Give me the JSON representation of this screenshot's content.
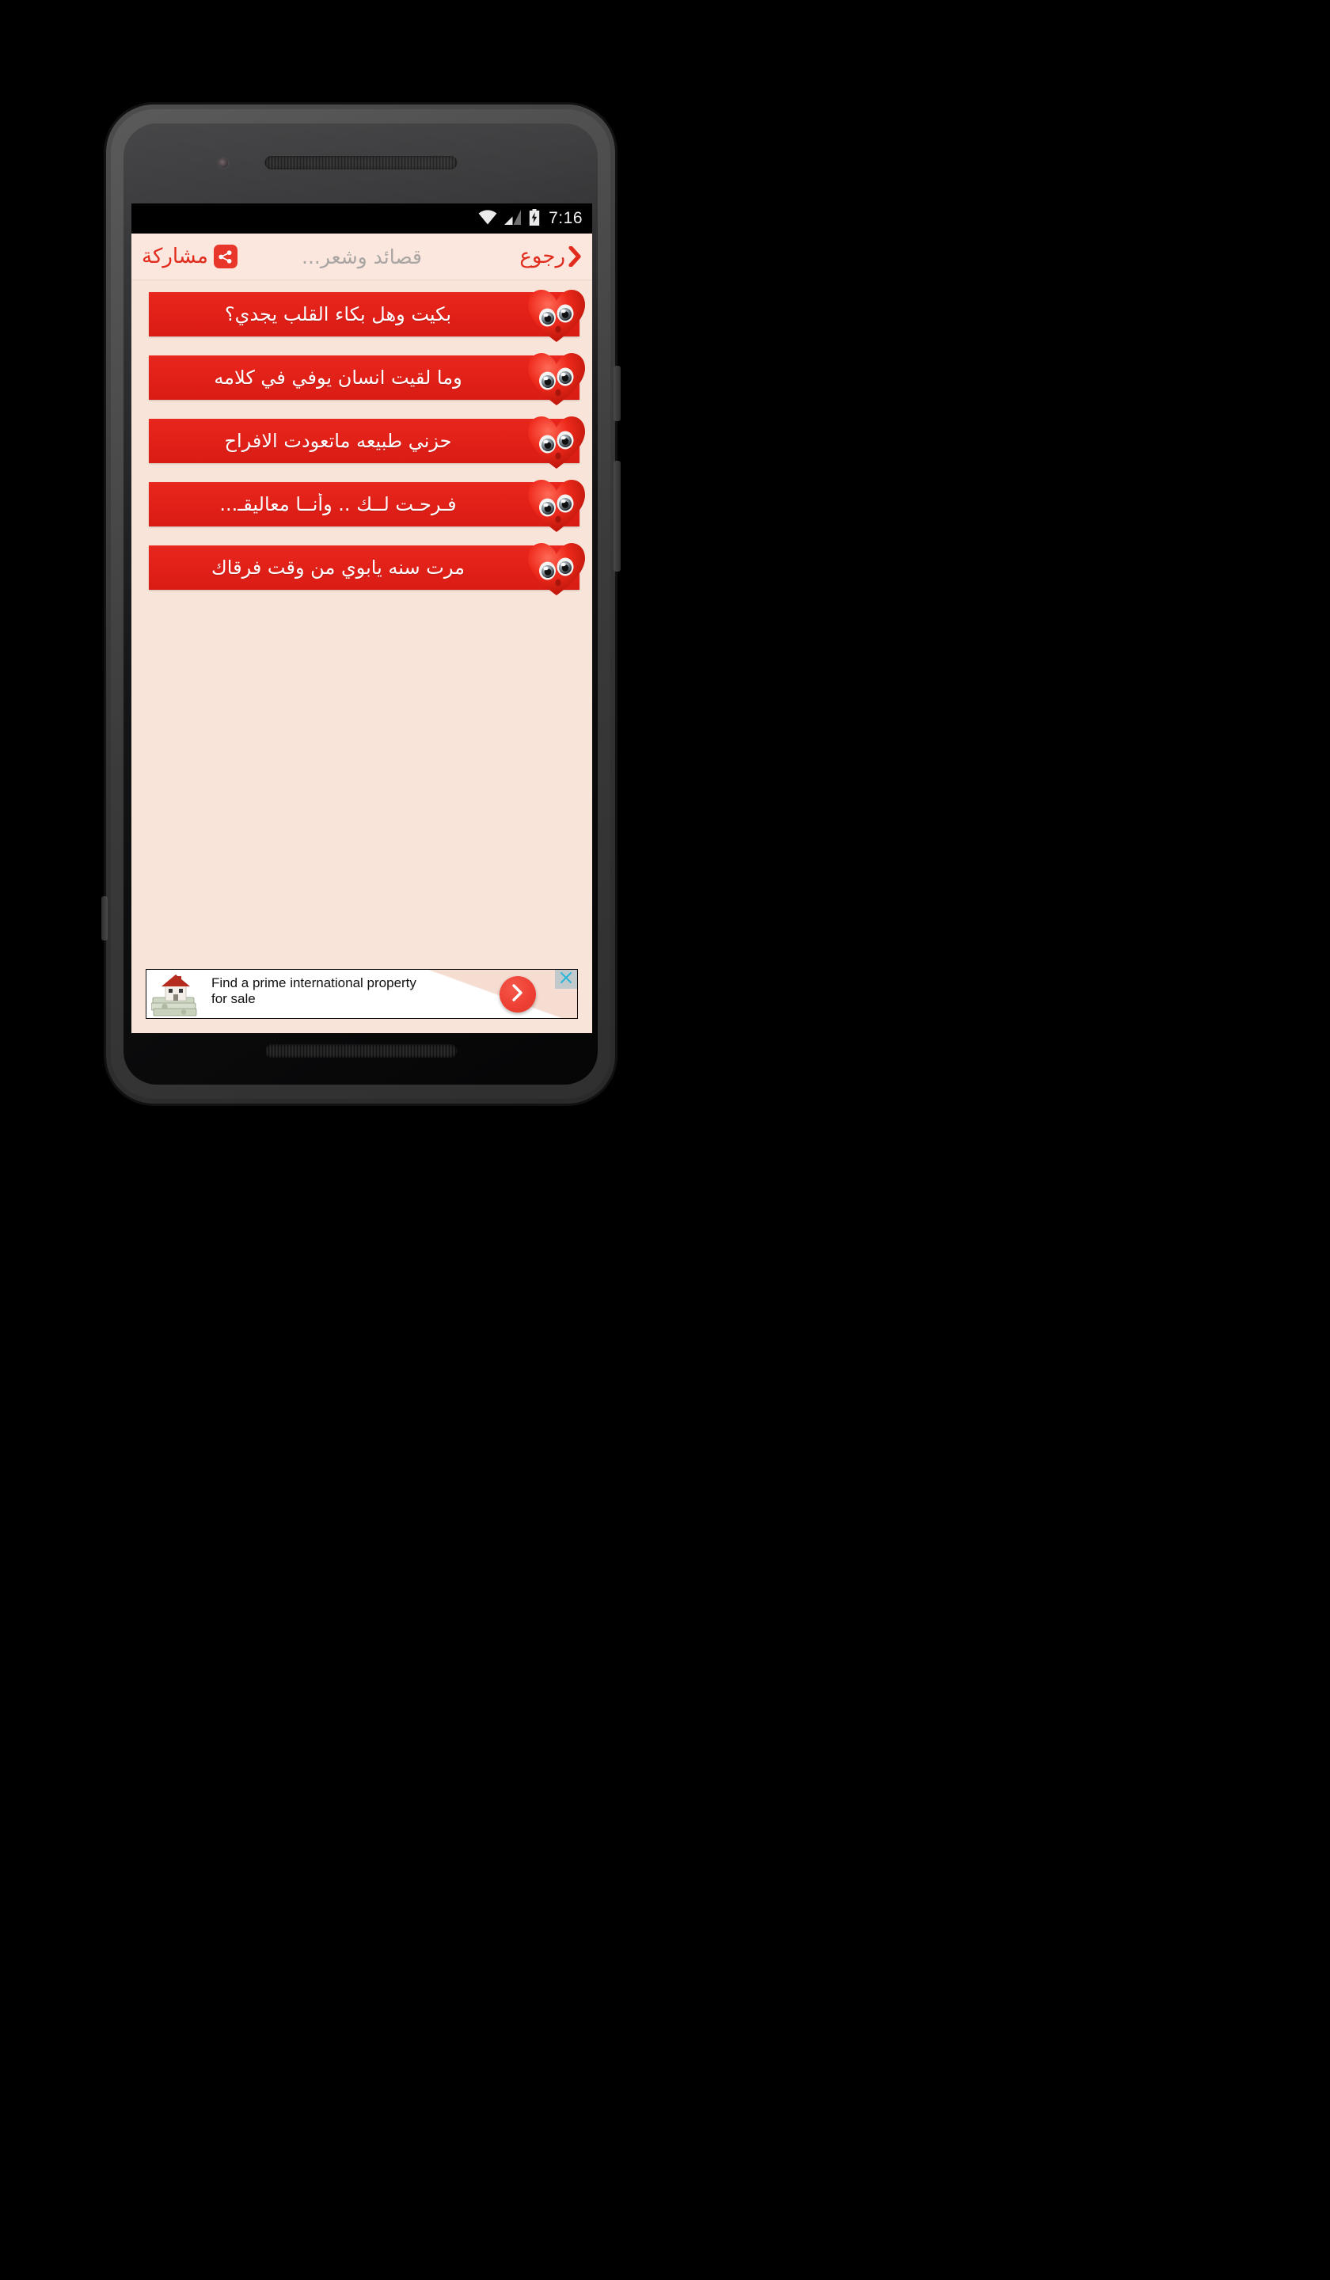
{
  "status_bar": {
    "time": "7:16",
    "icons": [
      "wifi-icon",
      "cellular-signal-icon",
      "battery-charging-icon"
    ]
  },
  "app_bar": {
    "back_label": "رجوع",
    "back_icon": "chevron-right-icon",
    "title": "قصائد وشعر...",
    "share_label": "مشاركة",
    "share_icon": "share-icon",
    "background_color": "#fbe7de",
    "accent_color": "#e02b1d",
    "title_color": "#a9a5a3"
  },
  "screen": {
    "background_color": "#f9e4da"
  },
  "list": {
    "item_color": "#e8261c",
    "item_text_color": "#ffffff",
    "item_icon": "crying-heart-icon",
    "items": [
      {
        "text": "بكيت وهل بكاء القلب يجدي؟"
      },
      {
        "text": "وما لقيت انسان يوفي في كلامه"
      },
      {
        "text": "حزني طبيعه ماتعودت الافراح"
      },
      {
        "text": "فـرحـت لــك .. وأنــا معاليقـ..."
      },
      {
        "text": "مرت سنه يابوي من وقت فرقاك"
      }
    ]
  },
  "ad": {
    "headline_line1": "Find a prime international property",
    "headline_line2": "for sale",
    "thumb_icon": "house-on-money-icon",
    "cta_icon": "chevron-right-icon",
    "close_icon": "close-x-icon",
    "cta_color": "#ee4034",
    "close_color": "#29b6d8"
  }
}
